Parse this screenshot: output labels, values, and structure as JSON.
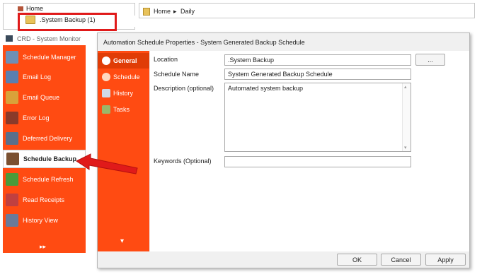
{
  "tree": {
    "home_label": "Home",
    "selected_folder": ".System Backup (1)"
  },
  "breadcrumb": {
    "home": "Home",
    "current": "Daily"
  },
  "monitor": {
    "title": "CRD - System Monitor",
    "items": [
      {
        "label": "Schedule Manager"
      },
      {
        "label": "Email Log"
      },
      {
        "label": "Email Queue"
      },
      {
        "label": "Error Log"
      },
      {
        "label": "Deferred Delivery"
      },
      {
        "label": "Schedule Backup",
        "active": true
      },
      {
        "label": "Schedule Refresh"
      },
      {
        "label": "Read Receipts"
      },
      {
        "label": "History View"
      }
    ],
    "more_glyph": "▸▸"
  },
  "dialog": {
    "title": "Automation Schedule Properties - System Generated Backup Schedule",
    "nav": [
      {
        "label": "General",
        "active": true
      },
      {
        "label": "Schedule"
      },
      {
        "label": "History"
      },
      {
        "label": "Tasks"
      }
    ],
    "nav_down_glyph": "▾",
    "fields": {
      "location_label": "Location",
      "location_value": ".System Backup",
      "browse_label": "...",
      "name_label": "Schedule Name",
      "name_value": "System Generated Backup Schedule",
      "description_label": "Description (optional)",
      "description_value": "Automated system backup",
      "keywords_label": "Keywords (Optional)",
      "keywords_value": ""
    },
    "buttons": {
      "ok": "OK",
      "cancel": "Cancel",
      "apply": "Apply"
    }
  },
  "colors": {
    "accent": "#ff4b12",
    "highlight_red": "#e01a1a"
  }
}
